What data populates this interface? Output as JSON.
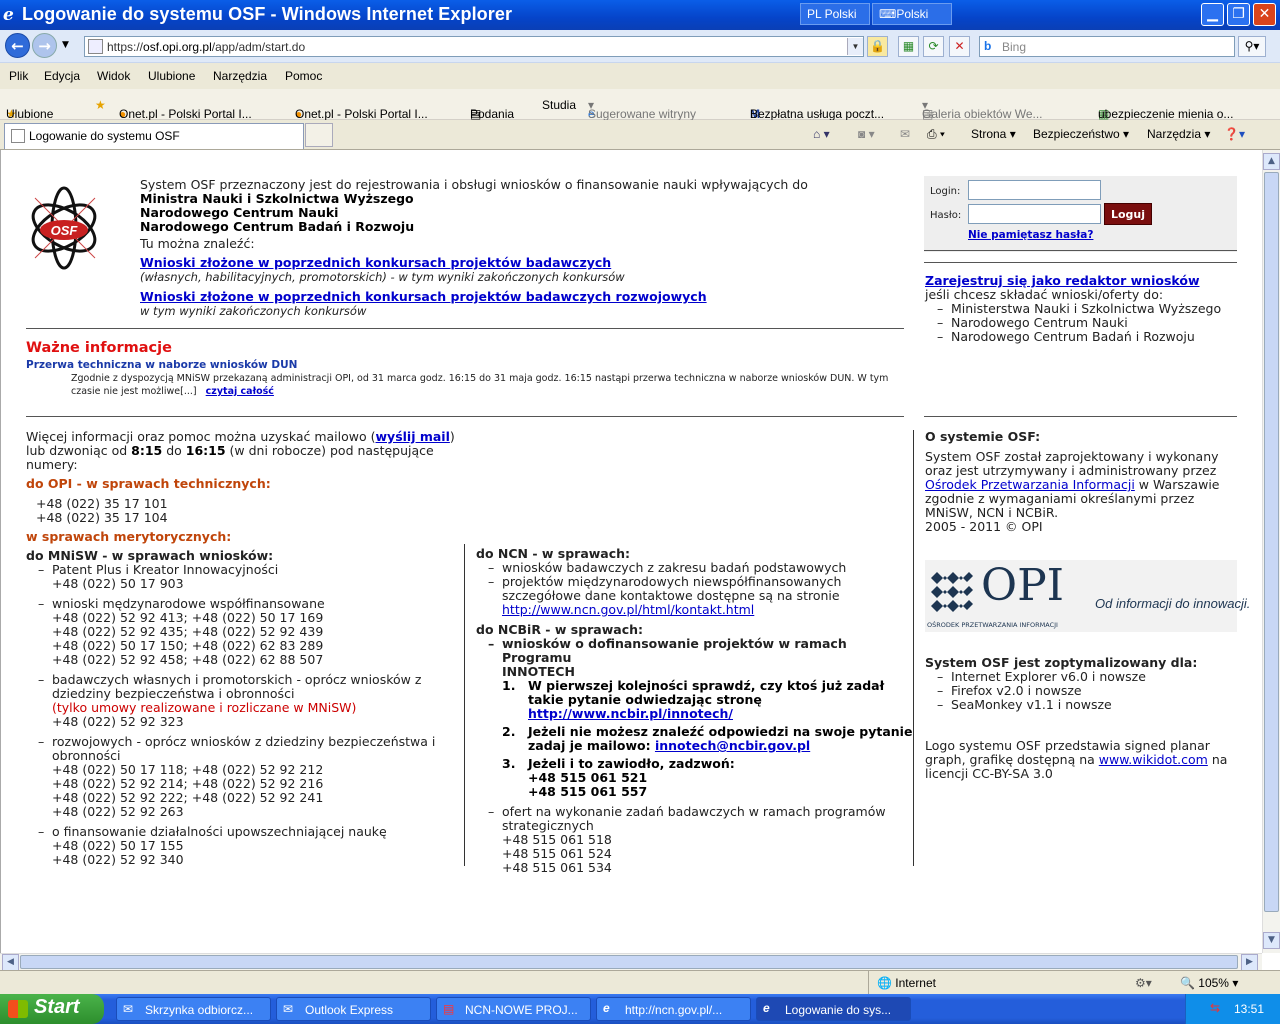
{
  "window": {
    "title": "Logowanie do systemu OSF - Windows Internet Explorer",
    "lang1": "PL Polski",
    "lang2": "Polski"
  },
  "address": {
    "prefix": "https://",
    "domain": "osf.opi.org.pl",
    "path": "/app/adm/start.do",
    "search_placeholder": "Bing"
  },
  "menu": [
    "Plik",
    "Edycja",
    "Widok",
    "Ulubione",
    "Narzędzia",
    "Pomoc"
  ],
  "favorites": {
    "label": "Ulubione",
    "items": [
      "Onet.pl - Polski Portal I...",
      "Onet.pl - Polski Portal I...",
      "Podania",
      "Studia",
      "Sugerowane witryny",
      "Bezpłatna usługa poczt...",
      "Galeria obiektów We...",
      "ubezpieczenie mienia o..."
    ]
  },
  "tab": {
    "title": "Logowanie do systemu OSF",
    "cmd_strona": "Strona",
    "cmd_bezp": "Bezpieczeństwo",
    "cmd_narz": "Narzędzia"
  },
  "intro": {
    "line1": "System OSF przeznaczony jest do rejestrowania i obsługi wniosków o finansowanie nauki wpływających do",
    "inst1": "Ministra Nauki i Szkolnictwa Wyższego",
    "inst2": "Narodowego Centrum Nauki",
    "inst3": "Narodowego Centrum Badań i Rozwoju",
    "find": "Tu można znaleźć:",
    "link1": "Wnioski złożone w poprzednich konkursach projektów badawczych",
    "link1_desc": "(własnych, habilitacyjnych, promotorskich) - w tym wyniki zakończonych konkursów",
    "link2": "Wnioski złożone w poprzednich konkursach projektów badawczych rozwojowych",
    "link2_desc": "w tym wyniki zakończonych konkursów",
    "logo_text": "OSF"
  },
  "login": {
    "login_label": "Login:",
    "pass_label": "Hasło:",
    "button": "Loguj",
    "forgot": "Nie pamiętasz hasła?"
  },
  "register": {
    "link": "Zarejestruj się jako redaktor wniosków",
    "desc": "jeśli chcesz składać wnioski/oferty do:",
    "items": [
      "Ministerstwa Nauki i Szkolnictwa Wyższego",
      "Narodowego Centrum Nauki",
      "Narodowego Centrum Badań i Rozwoju"
    ]
  },
  "news": {
    "heading": "Ważne informacje",
    "title": "Przerwa techniczna w naborze wniosków DUN",
    "body1": "Zgodnie z dyspozycją MNiSW przekazaną administracji OPI,  od 31 marca godz. 16:15 do 31 maja godz. 16:15 nastąpi przerwa techniczna w naborze wniosków DUN. W tym",
    "body2": "czasie nie jest możliwe[...]",
    "more": "czytaj całość"
  },
  "contact": {
    "l1a": "Więcej informacji oraz pomoc można uzyskać mailowo (",
    "l1link": "wyślij mail",
    "l1b": ")",
    "l2a": "lub dzwoniąc od ",
    "t1": "8:15",
    "l2b": " do ",
    "t2": "16:15",
    "l2c": " (w dni robocze) pod następujące",
    "l3": "numery:",
    "opi_head": "do OPI - w sprawach technicznych:",
    "opi_nums": [
      "+48 (022) 35 17 101",
      "+48 (022) 35 17 104"
    ],
    "merit_head": "w sprawach merytorycznych:",
    "mnisw_head": "do MNiSW - w sprawach wniosków:",
    "mnisw_1": "Patent Plus i Kreator Innowacyjności",
    "mnisw_1n": "+48 (022) 50 17 903",
    "mnisw_2": "wnioski mędzynarodowe współfinansowane",
    "mnisw_2n": [
      "+48 (022) 52 92 413; +48 (022) 50 17 169",
      "+48 (022) 52 92 435; +48 (022) 52 92 439",
      "+48 (022) 50 17 150; +48 (022) 62 83 289",
      "+48 (022) 52 92 458; +48 (022) 62 88 507"
    ],
    "mnisw_3a": "badawczych własnych i promotorskich - oprócz wniosków z",
    "mnisw_3b": "dziedziny bezpieczeństwa i obronności",
    "mnisw_3red": "(tylko umowy realizowane i rozliczane w MNiSW)",
    "mnisw_3n": "+48 (022) 52 92 323",
    "mnisw_4a": "rozwojowych - oprócz wniosków z dziedziny bezpieczeństwa i",
    "mnisw_4b": "obronności",
    "mnisw_4n": [
      "+48 (022) 50 17 118; +48 (022) 52 92 212",
      "+48 (022) 52 92 214; +48 (022) 52 92 216",
      "+48 (022) 52 92 222; +48 (022) 52 92 241",
      "+48 (022) 52 92 263"
    ],
    "mnisw_5": "o finansowanie działalności upowszechniającej naukę",
    "mnisw_5n": [
      "+48 (022) 50 17 155",
      "+48 (022) 52 92 340"
    ],
    "ncn_head": "do NCN - w sprawach:",
    "ncn_1": "wniosków badawczych z zakresu badań podstawowych",
    "ncn_2a": "projektów międzynarodowych niewspółfinansowanych",
    "ncn_2b": "szczegółowe dane kontaktowe dostępne są na stronie",
    "ncn_link": "http://www.ncn.gov.pl/html/kontakt.html",
    "ncbir_head": "do NCBiR - w sprawach:",
    "ncbir_1a": "wniosków o dofinansowanie projektów w ramach Programu",
    "ncbir_1b": "INNOTECH",
    "step1a": "W pierwszej kolejności sprawdź, czy ktoś już zadał",
    "step1b": "takie pytanie odwiedzając stronę",
    "step1link": "http://www.ncbir.pl/innotech/",
    "step2a": "Jeżeli nie możesz znaleźć odpowiedzi na swoje pytanie",
    "step2b": "zadaj je mailowo: ",
    "step2link": "innotech@ncbir.gov.pl",
    "step3": "Jeżeli i to zawiodło, zadzwoń:",
    "step3n": [
      "+48 515 061 521",
      "+48 515 061 557"
    ],
    "ncbir_2a": "ofert na wykonanie zadań badawczych w ramach programów",
    "ncbir_2b": "strategicznych",
    "ncbir_2n": [
      "+48 515 061 518",
      "+48 515 061 524",
      "+48 515 061 534"
    ]
  },
  "about": {
    "head": "O systemie OSF:",
    "l1": "System OSF został zaprojektowany i wykonany",
    "l2": "oraz jest utrzymywany i administrowany przez",
    "link": "Ośrodek Przetwarzania Informacji",
    "l3b": " w Warszawie",
    "l4": "zgodnie z wymaganiami określanymi przez",
    "l5": "MNiSW, NCN i NCBiR.",
    "l6": "2005 - 2011 © OPI",
    "opi_logo": "OPI",
    "opi_sub": "OŚRODEK PRZETWARZANIA INFORMACJI",
    "opi_slogan": "Od informacji do innowacji.",
    "opt_head": "System OSF jest zoptymalizowany dla:",
    "browsers": [
      "Internet Explorer v6.0 i nowsze",
      "Firefox v2.0 i nowsze",
      "SeaMonkey v1.1 i nowsze"
    ],
    "logo1": "Logo systemu OSF przedstawia signed planar",
    "logo2a": "graph, grafikę dostępną na ",
    "logo_link": "www.wikidot.com",
    "logo2b": " na",
    "logo3": "licencji CC-BY-SA 3.0"
  },
  "status": {
    "zone": "Internet",
    "zoom": "105%"
  },
  "taskbar": {
    "start": "Start",
    "tasks": [
      "Skrzynka odbiorcz...",
      "Outlook Express",
      "NCN-NOWE PROJ...",
      "http://ncn.gov.pl/...",
      "Logowanie do sys..."
    ],
    "clock": "13:51"
  }
}
